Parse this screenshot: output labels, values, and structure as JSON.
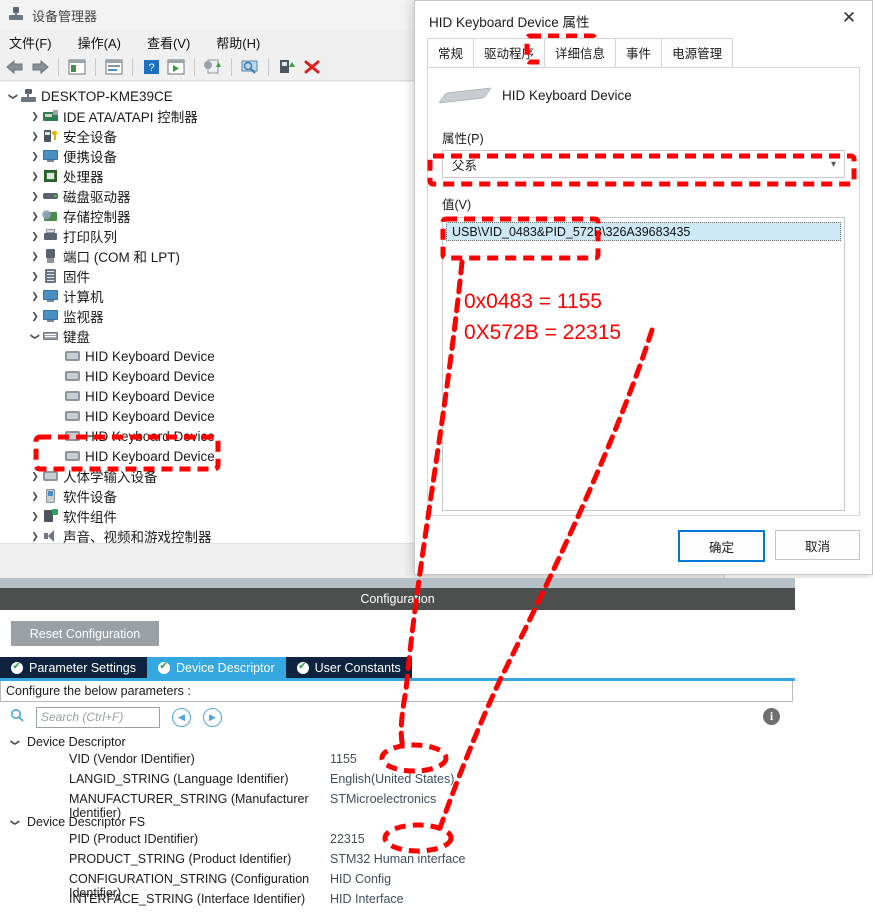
{
  "device_manager": {
    "window_title": "设备管理器",
    "app_icon": "device-manager-icon",
    "menu": [
      "文件(F)",
      "操作(A)",
      "查看(V)",
      "帮助(H)"
    ],
    "toolbar_icons": [
      "back-arrow-icon",
      "forward-arrow-icon",
      "show-hide-console-tree-icon",
      "properties-icon",
      "help-icon",
      "scan-icon",
      "update-driver-icon",
      "scan-hardware-changes-icon",
      "enable-device-icon",
      "uninstall-device-icon"
    ],
    "tree": [
      {
        "label": "DESKTOP-KME39CE",
        "indent": 0,
        "state": "open",
        "icon": "computer-icon"
      },
      {
        "label": "IDE ATA/ATAPI 控制器",
        "indent": 1,
        "state": "closed",
        "icon": "ide-controller-icon"
      },
      {
        "label": "安全设备",
        "indent": 1,
        "state": "closed",
        "icon": "security-device-icon"
      },
      {
        "label": "便携设备",
        "indent": 1,
        "state": "closed",
        "icon": "portable-device-icon"
      },
      {
        "label": "处理器",
        "indent": 1,
        "state": "closed",
        "icon": "processor-icon"
      },
      {
        "label": "磁盘驱动器",
        "indent": 1,
        "state": "closed",
        "icon": "disk-drive-icon"
      },
      {
        "label": "存储控制器",
        "indent": 1,
        "state": "closed",
        "icon": "storage-controller-icon"
      },
      {
        "label": "打印队列",
        "indent": 1,
        "state": "closed",
        "icon": "print-queue-icon"
      },
      {
        "label": "端口 (COM 和 LPT)",
        "indent": 1,
        "state": "closed",
        "icon": "port-icon"
      },
      {
        "label": "固件",
        "indent": 1,
        "state": "closed",
        "icon": "firmware-icon"
      },
      {
        "label": "计算机",
        "indent": 1,
        "state": "closed",
        "icon": "computer-node-icon"
      },
      {
        "label": "监视器",
        "indent": 1,
        "state": "closed",
        "icon": "monitor-icon"
      },
      {
        "label": "键盘",
        "indent": 1,
        "state": "open",
        "icon": "keyboard-icon"
      },
      {
        "label": "HID Keyboard Device",
        "indent": 2,
        "state": "leaf",
        "icon": "hid-keyboard-icon"
      },
      {
        "label": "HID Keyboard Device",
        "indent": 2,
        "state": "leaf",
        "icon": "hid-keyboard-icon"
      },
      {
        "label": "HID Keyboard Device",
        "indent": 2,
        "state": "leaf",
        "icon": "hid-keyboard-icon"
      },
      {
        "label": "HID Keyboard Device",
        "indent": 2,
        "state": "leaf",
        "icon": "hid-keyboard-icon"
      },
      {
        "label": "HID Keyboard Device",
        "indent": 2,
        "state": "leaf",
        "icon": "hid-keyboard-icon"
      },
      {
        "label": "HID Keyboard Device",
        "indent": 2,
        "state": "leaf",
        "icon": "hid-keyboard-icon"
      },
      {
        "label": "人体学输入设备",
        "indent": 1,
        "state": "closed",
        "icon": "human-interface-device-icon"
      },
      {
        "label": "软件设备",
        "indent": 1,
        "state": "closed",
        "icon": "software-device-icon"
      },
      {
        "label": "软件组件",
        "indent": 1,
        "state": "closed",
        "icon": "software-component-icon"
      },
      {
        "label": "声音、视频和游戏控制器",
        "indent": 1,
        "state": "closed",
        "icon": "sound-video-game-controller-icon"
      }
    ]
  },
  "dialog": {
    "title": "HID Keyboard Device 属性",
    "close_icon": "close-icon",
    "tabs": [
      {
        "label": "常规",
        "active": false
      },
      {
        "label": "驱动程序",
        "active": false
      },
      {
        "label": "详细信息",
        "active": true
      },
      {
        "label": "事件",
        "active": false
      },
      {
        "label": "电源管理",
        "active": false
      }
    ],
    "device_name": "HID Keyboard Device",
    "device_icon": "keyboard-illustration-icon",
    "property_label": "属性(P)",
    "property_selected": "父系",
    "value_label": "值(V)",
    "value_selected": "USB\\VID_0483&PID_572B\\326A39683435",
    "buttons": {
      "ok": "确定",
      "cancel": "取消"
    }
  },
  "configuration": {
    "header": "Configuration",
    "reset_button": "Reset Configuration",
    "tabs": [
      {
        "label": "Parameter Settings",
        "active": false
      },
      {
        "label": "Device Descriptor",
        "active": true
      },
      {
        "label": "User Constants",
        "active": false
      }
    ],
    "note": "Configure the below parameters :",
    "search_placeholder": "Search (Ctrl+F)",
    "search_value": "",
    "nav_prev_icon": "chevron-left-circle-icon",
    "nav_next_icon": "chevron-right-circle-icon",
    "info_icon": "info-icon",
    "groups": [
      {
        "name": "Device Descriptor",
        "state": "open",
        "rows": [
          {
            "name": "VID (Vendor IDentifier)",
            "value": "1155"
          },
          {
            "name": "LANGID_STRING (Language Identifier)",
            "value": "English(United States)"
          },
          {
            "name": "MANUFACTURER_STRING (Manufacturer Identifier)",
            "value": "STMicroelectronics"
          }
        ]
      },
      {
        "name": "Device Descriptor FS",
        "state": "open",
        "rows": [
          {
            "name": "PID (Product IDentifier)",
            "value": "22315"
          },
          {
            "name": "PRODUCT_STRING (Product Identifier)",
            "value": "STM32 Human interface"
          },
          {
            "name": "CONFIGURATION_STRING (Configuration Identifier)",
            "value": "HID Config"
          },
          {
            "name": "INTERFACE_STRING (Interface Identifier)",
            "value": "HID Interface"
          }
        ]
      }
    ]
  },
  "annotations": {
    "color": "#ff0000",
    "line1": "0x0483 = 1155",
    "line2": "0X572B = 22315"
  }
}
